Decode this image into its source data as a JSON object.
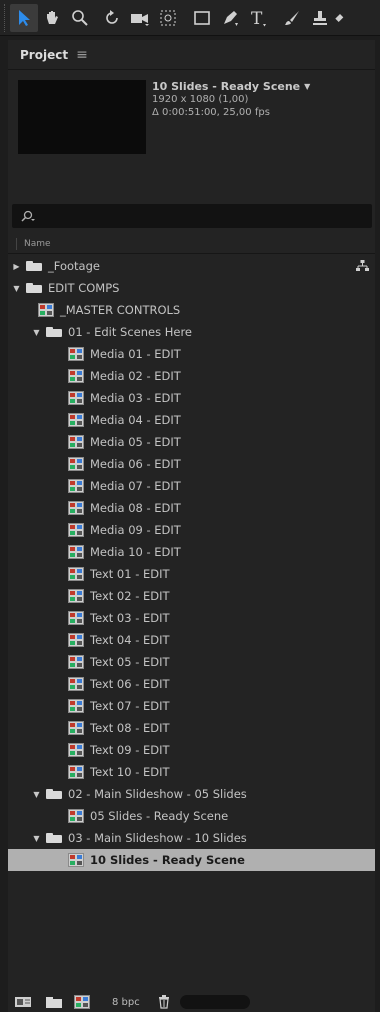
{
  "toolbar": {
    "tools": [
      "selection-tool",
      "hand-tool",
      "zoom-tool",
      "rotation-tool",
      "camera-tool",
      "pan-behind-tool",
      "rectangle-tool",
      "pen-tool",
      "type-tool",
      "brush-tool",
      "clone-stamp-tool",
      "eraser-tool"
    ]
  },
  "panel": {
    "title": "Project",
    "menu_icon": "≡"
  },
  "preview": {
    "comp_name": "10 Slides - Ready Scene",
    "dimensions": "1920 x 1080 (1,00)",
    "duration": "Δ 0:00:51:00, 25,00 fps"
  },
  "search": {
    "placeholder": ""
  },
  "header": {
    "name_col": "Name"
  },
  "tree": [
    {
      "label": "_Footage",
      "type": "folder",
      "indent": 0,
      "twist": "▶"
    },
    {
      "label": "EDIT COMPS",
      "type": "folder",
      "indent": 0,
      "twist": "▼"
    },
    {
      "label": "_MASTER CONTROLS",
      "type": "comp",
      "indent": 1,
      "twist": ""
    },
    {
      "label": "01 - Edit Scenes Here",
      "type": "folder",
      "indent": 1,
      "twist": "▼"
    },
    {
      "label": "Media 01 - EDIT",
      "type": "comp",
      "indent": 2,
      "twist": ""
    },
    {
      "label": "Media 02 - EDIT",
      "type": "comp",
      "indent": 2,
      "twist": ""
    },
    {
      "label": "Media 03 - EDIT",
      "type": "comp",
      "indent": 2,
      "twist": ""
    },
    {
      "label": "Media 04 - EDIT",
      "type": "comp",
      "indent": 2,
      "twist": ""
    },
    {
      "label": "Media 05 - EDIT",
      "type": "comp",
      "indent": 2,
      "twist": ""
    },
    {
      "label": "Media 06 - EDIT",
      "type": "comp",
      "indent": 2,
      "twist": ""
    },
    {
      "label": "Media 07 - EDIT",
      "type": "comp",
      "indent": 2,
      "twist": ""
    },
    {
      "label": "Media 08 - EDIT",
      "type": "comp",
      "indent": 2,
      "twist": ""
    },
    {
      "label": "Media 09 - EDIT",
      "type": "comp",
      "indent": 2,
      "twist": ""
    },
    {
      "label": "Media 10 - EDIT",
      "type": "comp",
      "indent": 2,
      "twist": ""
    },
    {
      "label": "Text 01 - EDIT",
      "type": "comp",
      "indent": 2,
      "twist": ""
    },
    {
      "label": "Text 02 - EDIT",
      "type": "comp",
      "indent": 2,
      "twist": ""
    },
    {
      "label": "Text 03 - EDIT",
      "type": "comp",
      "indent": 2,
      "twist": ""
    },
    {
      "label": "Text 04 - EDIT",
      "type": "comp",
      "indent": 2,
      "twist": ""
    },
    {
      "label": "Text 05 - EDIT",
      "type": "comp",
      "indent": 2,
      "twist": ""
    },
    {
      "label": "Text 06 - EDIT",
      "type": "comp",
      "indent": 2,
      "twist": ""
    },
    {
      "label": "Text 07 - EDIT",
      "type": "comp",
      "indent": 2,
      "twist": ""
    },
    {
      "label": "Text 08 - EDIT",
      "type": "comp",
      "indent": 2,
      "twist": ""
    },
    {
      "label": "Text 09 - EDIT",
      "type": "comp",
      "indent": 2,
      "twist": ""
    },
    {
      "label": "Text 10 - EDIT",
      "type": "comp",
      "indent": 2,
      "twist": ""
    },
    {
      "label": "02 - Main Slideshow - 05 Slides",
      "type": "folder",
      "indent": 1,
      "twist": "▼"
    },
    {
      "label": "05 Slides - Ready Scene",
      "type": "comp",
      "indent": 2,
      "twist": ""
    },
    {
      "label": "03 - Main Slideshow - 10 Slides",
      "type": "folder",
      "indent": 1,
      "twist": "▼"
    },
    {
      "label": "10 Slides - Ready Scene",
      "type": "comp",
      "indent": 2,
      "twist": "",
      "selected": true
    }
  ],
  "footer": {
    "bpc": "8 bpc"
  },
  "colors": {
    "accent": "#2d8ceb",
    "panel_bg": "#232323",
    "selection": "#b0b0b0"
  }
}
